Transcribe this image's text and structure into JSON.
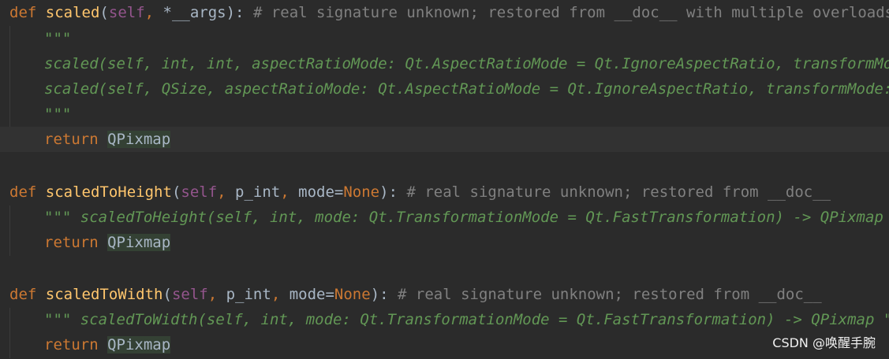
{
  "code": {
    "l1": {
      "def": "def",
      "name": "scaled",
      "open": "(",
      "self": "self",
      "sep": ", ",
      "params": "*__args",
      "close": "):",
      "comment": " # real signature unknown; restored from __doc__ with multiple overloads"
    },
    "l2": {
      "doc": "\"\"\""
    },
    "l3": {
      "doc": "scaled(self, int, int, aspectRatioMode: Qt.AspectRatioMode = Qt.IgnoreAspectRatio, transformMode: Q"
    },
    "l4": {
      "doc": "scaled(self, QSize, aspectRatioMode: Qt.AspectRatioMode = Qt.IgnoreAspectRatio, transformMode: Qt.Tr"
    },
    "l5": {
      "doc": "\"\"\""
    },
    "l6": {
      "ret": "return",
      "type": "QPixmap"
    },
    "l8": {
      "def": "def",
      "name": "scaledToHeight",
      "open": "(",
      "self": "self",
      "sep1": ", ",
      "p1": "p_int",
      "sep2": ", ",
      "p2": "mode",
      "eq": "=",
      "none": "None",
      "close": "):",
      "comment": " # real signature unknown; restored from __doc__"
    },
    "l9": {
      "doc": "\"\"\" scaledToHeight(self, int, mode: Qt.TransformationMode = Qt.FastTransformation) -> QPixmap \"\"\""
    },
    "l10": {
      "ret": "return",
      "type": "QPixmap"
    },
    "l12": {
      "def": "def",
      "name": "scaledToWidth",
      "open": "(",
      "self": "self",
      "sep1": ", ",
      "p1": "p_int",
      "sep2": ", ",
      "p2": "mode",
      "eq": "=",
      "none": "None",
      "close": "):",
      "comment": " # real signature unknown; restored from __doc__"
    },
    "l13": {
      "doc": "\"\"\" scaledToWidth(self, int, mode: Qt.TransformationMode = Qt.FastTransformation) -> QPixmap \"\"\""
    },
    "l14": {
      "ret": "return",
      "type": "QPixmap"
    }
  },
  "watermark": "CSDN @唤醒手腕",
  "colors": {
    "background": "#2b2b2b",
    "current_line": "#323232",
    "keyword": "#cc7832",
    "function": "#ffc66d",
    "self": "#94558d",
    "comment": "#808080",
    "docstring": "#629755",
    "text": "#a9b7c6"
  }
}
